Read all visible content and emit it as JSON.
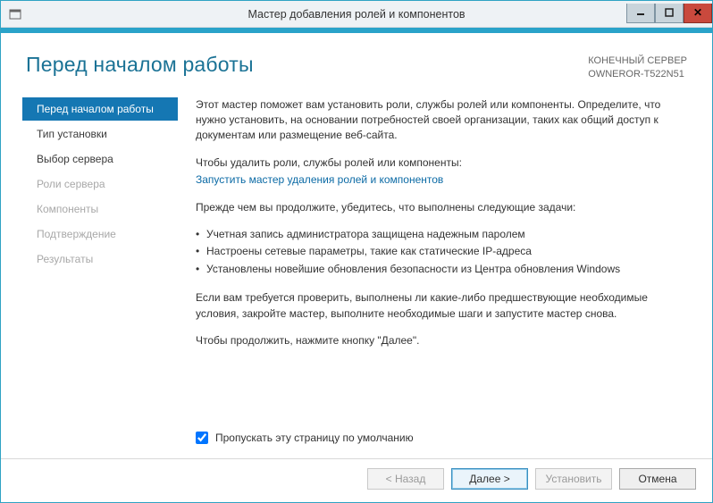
{
  "titlebar": {
    "title": "Мастер добавления ролей и компонентов"
  },
  "header": {
    "page_title": "Перед началом работы",
    "server_label": "КОНЕЧНЫЙ СЕРВЕР",
    "server_name": "OWNEROR-T522N51"
  },
  "sidebar": {
    "steps": [
      {
        "label": "Перед началом работы",
        "state": "active"
      },
      {
        "label": "Тип установки",
        "state": "enabled"
      },
      {
        "label": "Выбор сервера",
        "state": "enabled"
      },
      {
        "label": "Роли сервера",
        "state": "disabled"
      },
      {
        "label": "Компоненты",
        "state": "disabled"
      },
      {
        "label": "Подтверждение",
        "state": "disabled"
      },
      {
        "label": "Результаты",
        "state": "disabled"
      }
    ]
  },
  "content": {
    "intro": "Этот мастер поможет вам установить роли, службы ролей или компоненты. Определите, что нужно установить, на основании потребностей своей организации, таких как общий доступ к документам или размещение веб-сайта.",
    "remove_intro": "Чтобы удалить роли, службы ролей или компоненты:",
    "remove_link": "Запустить мастер удаления ролей и компонентов",
    "precheck_intro": "Прежде чем вы продолжите, убедитесь, что выполнены следующие задачи:",
    "bullets": [
      "Учетная запись администратора защищена надежным паролем",
      "Настроены сетевые параметры, такие как статические IP-адреса",
      "Установлены новейшие обновления безопасности из Центра обновления Windows"
    ],
    "verify_note": "Если вам требуется проверить, выполнены ли какие-либо предшествующие необходимые условия, закройте мастер, выполните необходимые шаги и запустите мастер снова.",
    "continue_note": "Чтобы продолжить, нажмите кнопку \"Далее\".",
    "skip_checkbox_label": "Пропускать эту страницу по умолчанию",
    "skip_checked": true
  },
  "footer": {
    "back": "< Назад",
    "next": "Далее >",
    "install": "Установить",
    "cancel": "Отмена"
  }
}
